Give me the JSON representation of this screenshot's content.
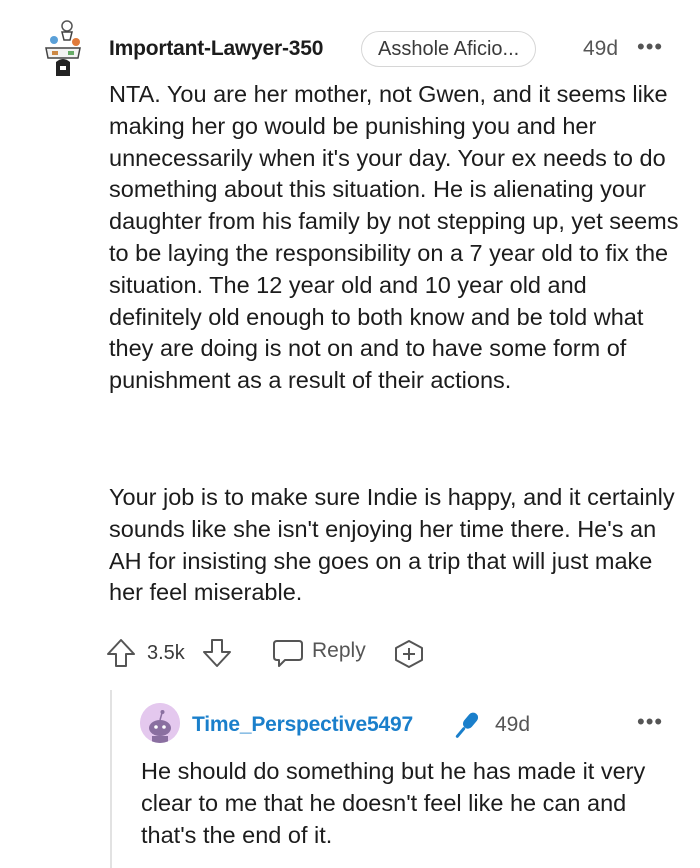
{
  "comment": {
    "username": "Important-Lawyer-350",
    "flair": "Asshole Aficio...",
    "age": "49d",
    "more_label": "•••",
    "paragraphs": [
      "NTA. You are her mother, not Gwen, and it seems like making her go would be punishing you and her unnecessarily when it's your day. Your ex needs to do something about this situation. He is alienating your daughter from his family by not stepping up, yet seems to be laying the responsibility on a 7 year old to fix the situation. The 12 year old and 10 year old and definitely old enough to both know and be told what they are doing is not on and to have some form of punishment as a result of their actions.",
      "Your job is to make sure Indie is happy, and it certainly sounds like she isn't enjoying her time there. He's an AH for insisting she goes on a trip that will just make her feel miserable."
    ],
    "score": "3.5k",
    "reply_label": "Reply",
    "icons": [
      "upvote-icon",
      "downvote-icon",
      "reply-icon",
      "award-icon",
      "more-icon"
    ]
  },
  "reply": {
    "username": "Time_Perspective5497",
    "age": "49d",
    "more_label": "•••",
    "text": "He should do something but he has made it very clear to me that he doesn't feel like he can and that's the end of it.",
    "icons": [
      "microphone-icon",
      "more-icon"
    ]
  },
  "colors": {
    "reply_username": "#1a7fcb",
    "mic_icon": "#1a7fcb",
    "avatar_bg": "#e4c8ee",
    "text": "#1c1c1c",
    "meta": "#555555"
  }
}
